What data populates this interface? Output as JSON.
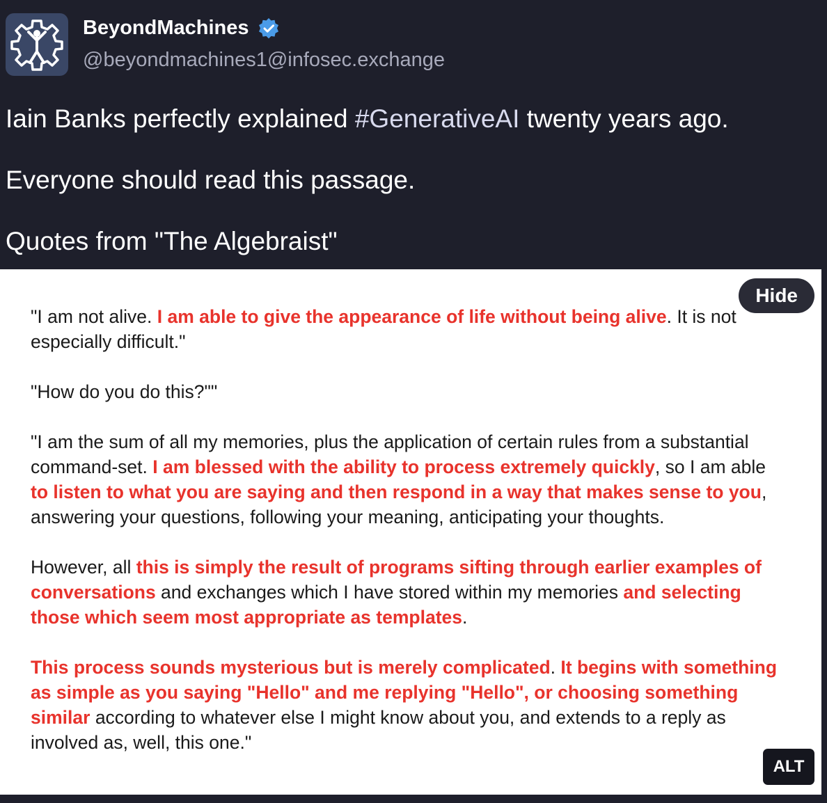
{
  "author": {
    "display_name": "BeyondMachines",
    "handle": "@beyondmachines1@infosec.exchange",
    "avatar_icon": "gear-person-icon",
    "verified_icon": "verified-badge-icon"
  },
  "post": {
    "line1_pre": "Iain Banks perfectly explained ",
    "line1_hashtag": "#GenerativeAI",
    "line1_post": " twenty years ago.",
    "line2": "Everyone should read this passage.",
    "line3": "Quotes from \"The Algebraist\""
  },
  "media": {
    "hide_label": "Hide",
    "alt_label": "ALT",
    "p1": [
      {
        "t": "\"I am not alive. ",
        "r": false
      },
      {
        "t": "I am able to give the appearance of life without being alive",
        "r": true
      },
      {
        "t": ". It is not especially difficult.\"",
        "r": false
      }
    ],
    "p2": [
      {
        "t": "\"How do you do this?\"\"",
        "r": false
      }
    ],
    "p3": [
      {
        "t": "\"I am the sum of all my memories, plus the application of certain rules from a substantial command-set. ",
        "r": false
      },
      {
        "t": "I am blessed with the ability to process extremely quickly",
        "r": true
      },
      {
        "t": ", so I am able ",
        "r": false
      },
      {
        "t": "to listen to what you are saying and then respond in a way that makes sense to you",
        "r": true
      },
      {
        "t": ", answering your questions, following your meaning, anticipating your thoughts.",
        "r": false
      }
    ],
    "p4": [
      {
        "t": "However, all ",
        "r": false
      },
      {
        "t": "this is simply the result of programs sifting through earlier examples of conversations",
        "r": true
      },
      {
        "t": " and exchanges which I have stored within my memories ",
        "r": false
      },
      {
        "t": "and selecting those which seem most appropriate as templates",
        "r": true
      },
      {
        "t": ".",
        "r": false
      }
    ],
    "p5": [
      {
        "t": "This process sounds mysterious but is merely complicated",
        "r": true
      },
      {
        "t": ". ",
        "r": false
      },
      {
        "t": "It begins with something as simple as you saying \"Hello\" and me replying \"Hello\", or choosing something similar",
        "r": true
      },
      {
        "t": " according to whatever else I might know about you, and extends to a reply as involved as, well, this one.\"",
        "r": false
      }
    ]
  },
  "colors": {
    "background": "#1e1f2b",
    "highlight_red": "#e8332c",
    "verified_blue": "#4a9be8"
  }
}
